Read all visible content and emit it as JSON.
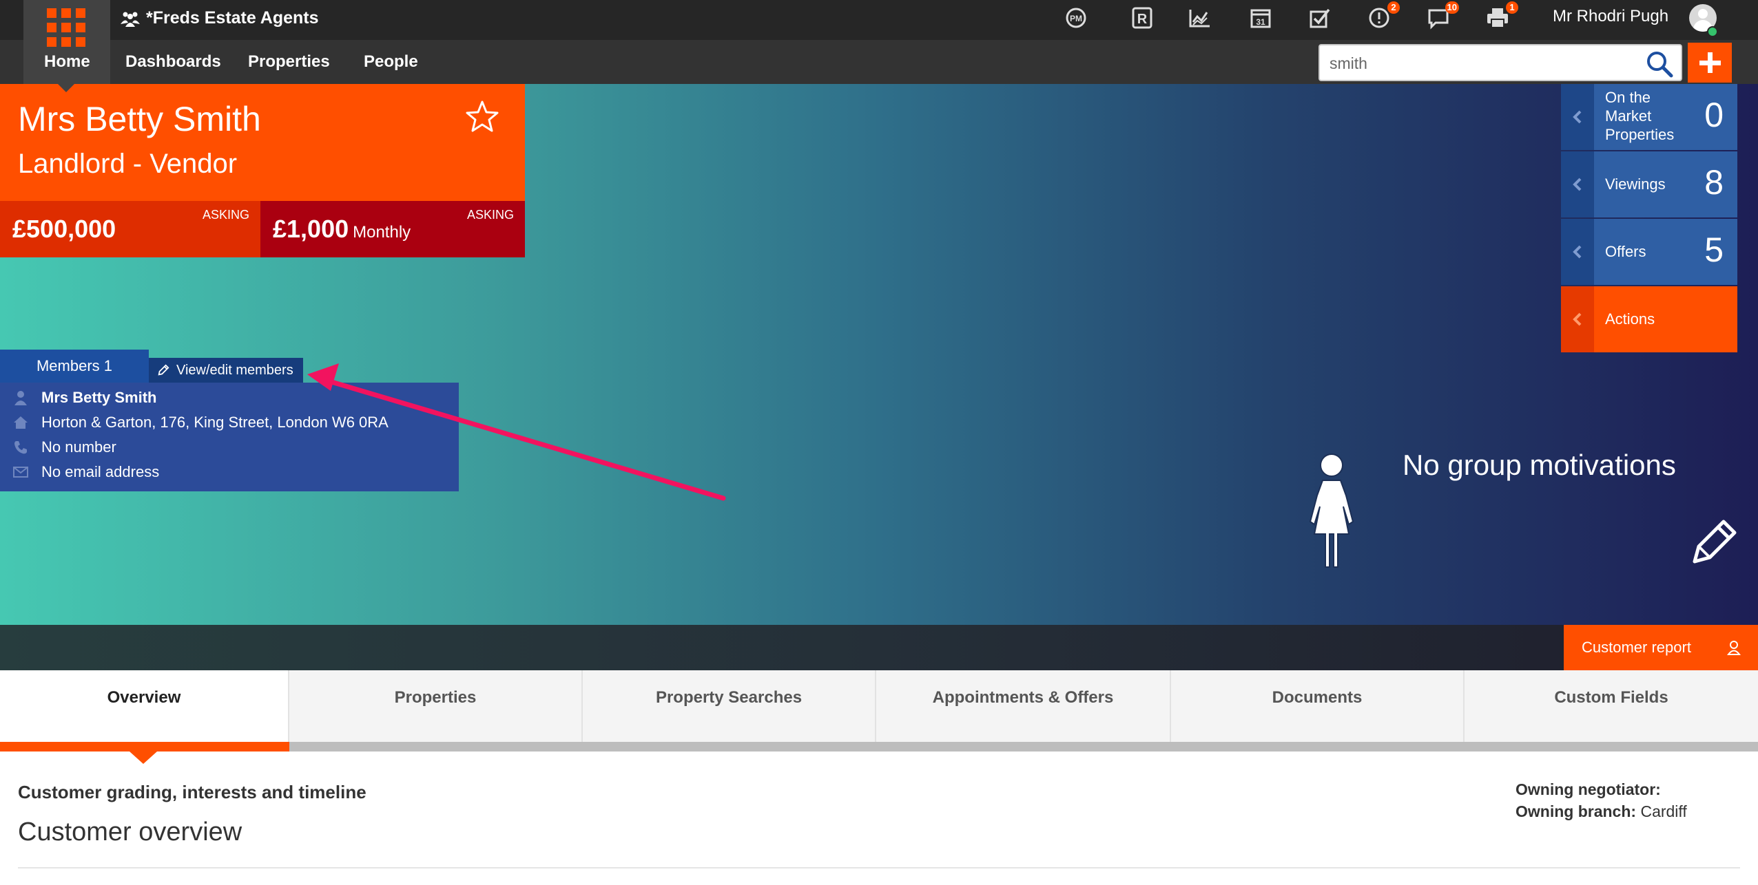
{
  "app": {
    "agency": "*Freds Estate Agents",
    "user": "Mr Rhodri Pugh"
  },
  "nav": {
    "home": "Home",
    "dashboards": "Dashboards",
    "properties": "Properties",
    "people": "People"
  },
  "toolbar": {
    "badges": {
      "alerts": "2",
      "messages": "10",
      "print": "1"
    }
  },
  "search": {
    "value": "smith"
  },
  "customer": {
    "name": "Mrs Betty Smith",
    "role": "Landlord - Vendor",
    "sale_price": "£500,000",
    "sale_tag": "ASKING",
    "let_price": "£1,000",
    "let_freq": "Monthly",
    "let_tag": "ASKING"
  },
  "members": {
    "tab": "Members 1",
    "edit": "View/edit members",
    "name": "Mrs Betty Smith",
    "address": "Horton & Garton, 176, King Street, London W6 0RA",
    "phone": "No number",
    "email": "No email address"
  },
  "stats": [
    {
      "label": "On the Market Properties",
      "value": "0"
    },
    {
      "label": "Viewings",
      "value": "8"
    },
    {
      "label": "Offers",
      "value": "5"
    },
    {
      "label": "Actions"
    }
  ],
  "motivations": "No group motivations",
  "customer_report": "Customer report",
  "tabs": [
    "Overview",
    "Properties",
    "Property Searches",
    "Appointments & Offers",
    "Documents",
    "Custom Fields"
  ],
  "overview": {
    "label": "Customer grading, interests and timeline",
    "title": "Customer overview",
    "negotiator_label": "Owning negotiator:",
    "branch_label": "Owning branch:",
    "branch_value": "Cardiff"
  },
  "colors": {
    "brand_orange": "#ff4f00",
    "topbar": "#262626",
    "navbar": "#333333",
    "stat_blue": "#2f5fa4",
    "members_blue": "#2c4b99"
  }
}
